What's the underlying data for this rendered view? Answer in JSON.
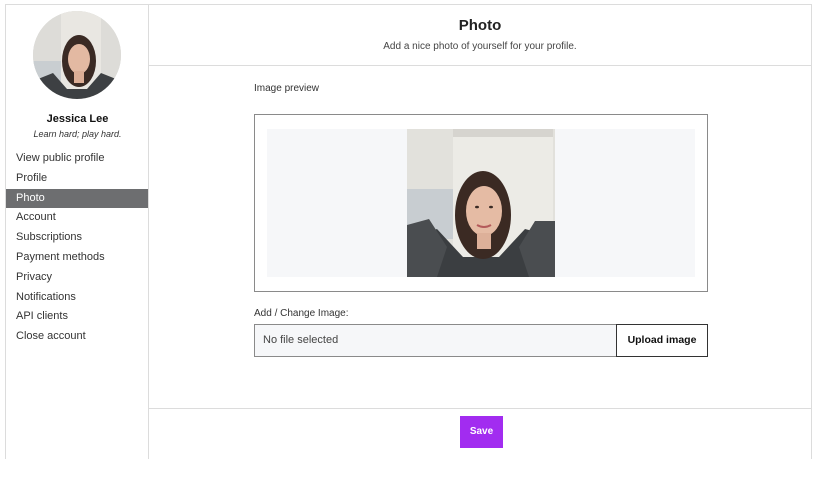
{
  "user": {
    "name": "Jessica Lee",
    "tagline": "Learn hard; play hard."
  },
  "sidebar": {
    "items": [
      {
        "label": "View public profile",
        "active": false
      },
      {
        "label": "Profile",
        "active": false
      },
      {
        "label": "Photo",
        "active": true
      },
      {
        "label": "Account",
        "active": false
      },
      {
        "label": "Subscriptions",
        "active": false
      },
      {
        "label": "Payment methods",
        "active": false
      },
      {
        "label": "Privacy",
        "active": false
      },
      {
        "label": "Notifications",
        "active": false
      },
      {
        "label": "API clients",
        "active": false
      },
      {
        "label": "Close account",
        "active": false
      }
    ]
  },
  "header": {
    "title": "Photo",
    "subtitle": "Add a nice photo of yourself for your profile."
  },
  "preview": {
    "label": "Image preview"
  },
  "upload": {
    "label": "Add / Change Image:",
    "file_status": "No file selected",
    "button_label": "Upload image"
  },
  "footer": {
    "save_label": "Save"
  },
  "colors": {
    "accent": "#a22cf0",
    "active_nav": "#6d6e70",
    "preview_bg": "#f6f7f9"
  }
}
